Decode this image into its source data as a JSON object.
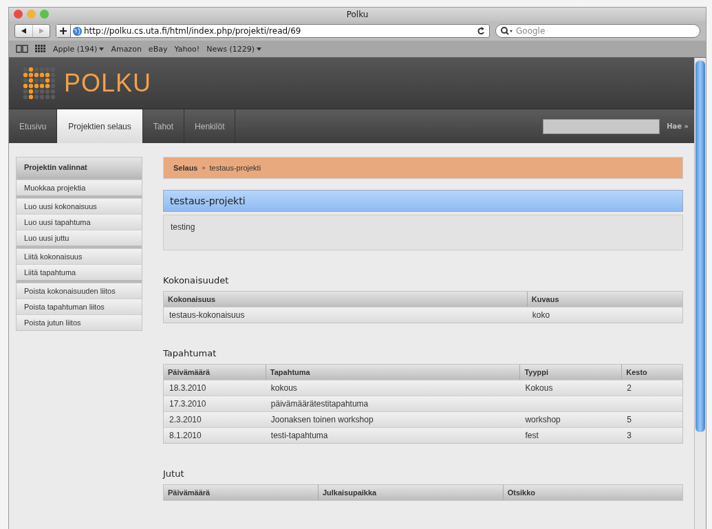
{
  "window": {
    "title": "Polku"
  },
  "toolbar": {
    "url": "http://polku.cs.uta.fi/html/index.php/projekti/read/69",
    "search_placeholder": "Google"
  },
  "bookmarks": [
    {
      "label": "Apple (194)",
      "menu": true
    },
    {
      "label": "Amazon",
      "menu": false
    },
    {
      "label": "eBay",
      "menu": false
    },
    {
      "label": "Yahoo!",
      "menu": false
    },
    {
      "label": "News (1229)",
      "menu": true
    }
  ],
  "site": {
    "logo": "POLKU",
    "search_button": "Hae »"
  },
  "tabs": [
    {
      "label": "Etusivu",
      "selected": false
    },
    {
      "label": "Projektien selaus",
      "selected": true
    },
    {
      "label": "Tahot",
      "selected": false
    },
    {
      "label": "Henkilöt",
      "selected": false
    }
  ],
  "sidebar": {
    "title": "Projektin valinnat",
    "groups": [
      [
        "Muokkaa projektia"
      ],
      [
        "Luo uusi kokonaisuus",
        "Luo uusi tapahtuma",
        "Luo uusi juttu"
      ],
      [
        "Liitä kokonaisuus",
        "Liitä tapahtuma"
      ],
      [
        "Poista kokonaisuuden liitos",
        "Poista tapahtuman liitos",
        "Poista jutun liitos"
      ]
    ]
  },
  "breadcrumb": {
    "root": "Selaus",
    "separator": "»",
    "current": "testaus-projekti"
  },
  "project": {
    "title": "testaus-projekti",
    "description": "testing"
  },
  "sections": [
    {
      "title": "Kokonaisuudet",
      "columns": [
        "Kokonaisuus",
        "Kuvaus"
      ],
      "rows": [
        [
          "testaus-kokonaisuus",
          "koko"
        ]
      ]
    },
    {
      "title": "Tapahtumat",
      "columns": [
        "Päivämäärä",
        "Tapahtuma",
        "Tyyppi",
        "Kesto"
      ],
      "rows": [
        [
          "18.3.2010",
          "kokous",
          "Kokous",
          "2"
        ],
        [
          "17.3.2010",
          "päivämäärätestitapahtuma",
          "",
          ""
        ],
        [
          "2.3.2010",
          "Joonaksen toinen workshop",
          "workshop",
          "5"
        ],
        [
          "8.1.2010",
          "testi-tapahtuma",
          "fest",
          "3"
        ]
      ]
    },
    {
      "title": "Jutut",
      "columns": [
        "Päivämäärä",
        "Julkaisupaikka",
        "Otsikko"
      ]
    }
  ]
}
